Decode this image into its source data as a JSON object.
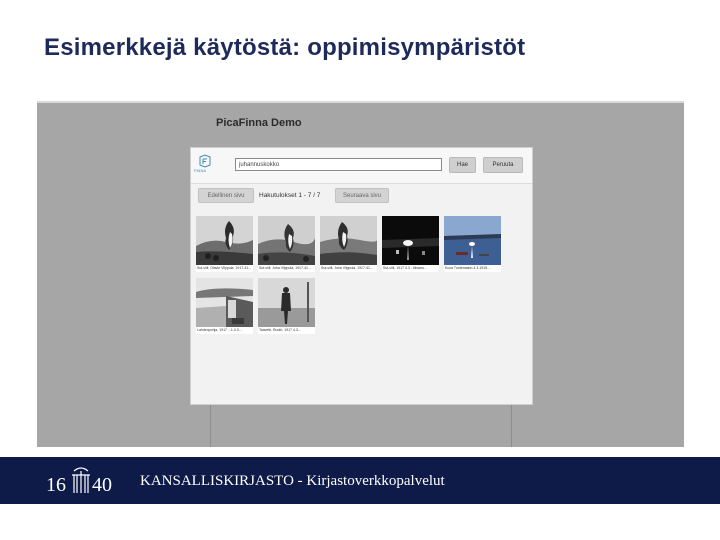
{
  "slide": {
    "title": "Esimerkkejä käytöstä: oppimisympäristöt"
  },
  "demo": {
    "title": "PicaFinna Demo",
    "logo_text": "FINNA",
    "search_value": "juhannuskokko",
    "search_button": "Hae",
    "cancel_button": "Peruuta",
    "prev_button": "Edellinen sivu",
    "results_label": "Hakutulokset 1 - 7 / 7",
    "next_button": "Seuraava sivu",
    "thumbnails": [
      {
        "caption": "Sut-viili, Olavin Vilppula, 1917-41..."
      },
      {
        "caption": "Sut-viili, Juha Vilppula, 1917-41..."
      },
      {
        "caption": "Sut-viili, Juha Vilppula, 1917-41..."
      },
      {
        "caption": "Sut-viili, 1917 4.3 - Nivanu..."
      },
      {
        "caption": "Kuva Tuntematon 4.3.1915..."
      },
      {
        "caption": "Lahdenpohja, 1917 ...1.4.3..."
      },
      {
        "caption": "Taavetti, Ruuth, 1917 4.3..."
      }
    ]
  },
  "footer": {
    "logo_text_left": "16",
    "logo_text_right": "40",
    "text": "KANSALLISKIRJASTO - Kirjastoverkkopalvelut"
  },
  "colors": {
    "title": "#1e2a5a",
    "footer_bg": "#0e1a48",
    "screenshot_bg": "#a6a6a6",
    "accent": "#3f8db6"
  }
}
